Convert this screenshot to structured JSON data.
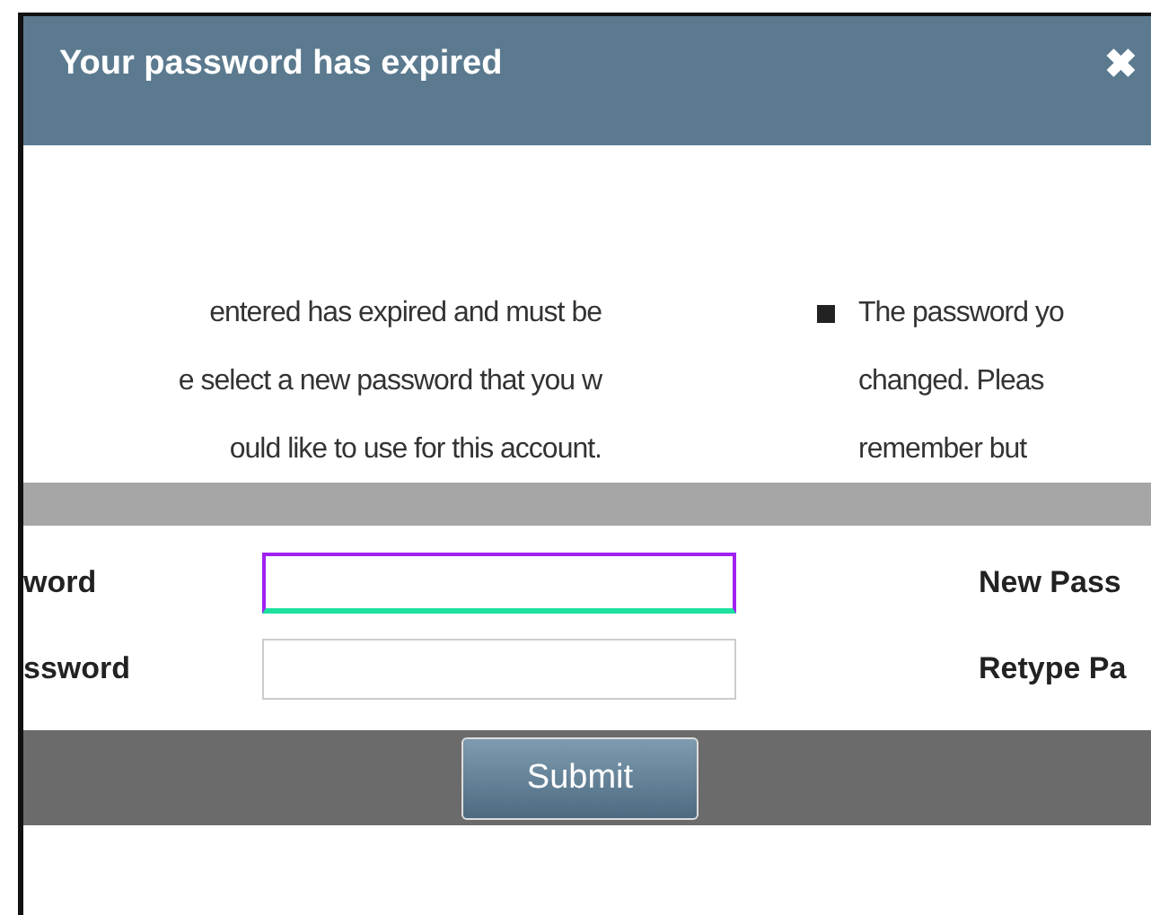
{
  "dialog": {
    "title": "Your password has expired",
    "close": "✖"
  },
  "message": {
    "left_lines": [
      "entered has expired and must be",
      "e select a new password that you w",
      "ould like to use for this account."
    ],
    "right_lines": [
      "The password yo",
      "changed. Pleas",
      "remember but"
    ]
  },
  "form": {
    "rows": [
      {
        "label": "word",
        "focused": true,
        "right_label": "New Pass"
      },
      {
        "label": "ssword",
        "focused": false,
        "right_label": "Retype Pa"
      }
    ]
  },
  "submit": "Submit"
}
